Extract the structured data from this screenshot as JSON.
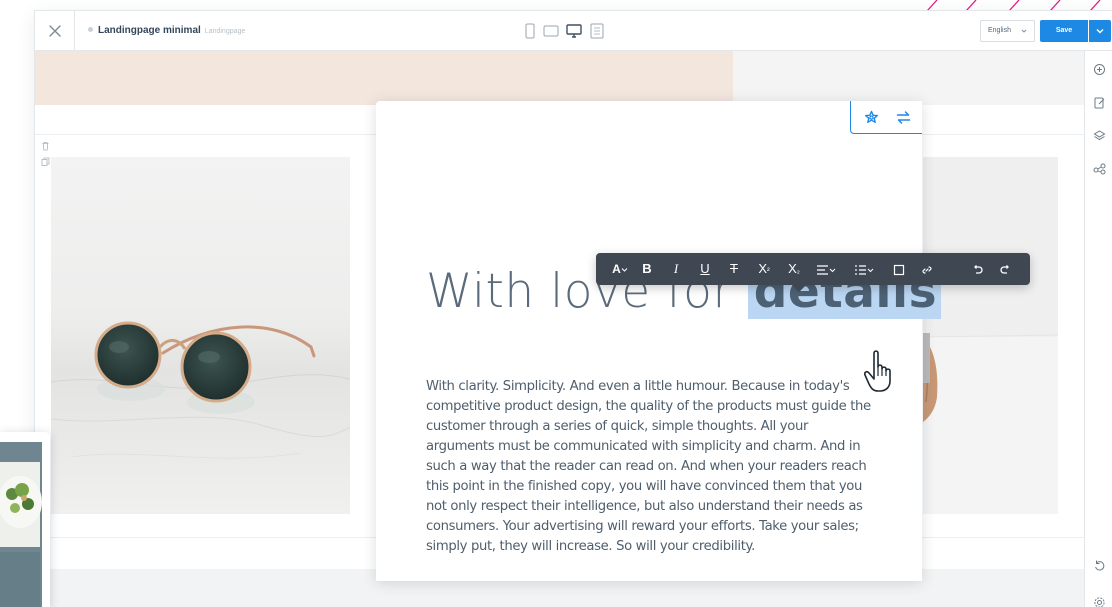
{
  "toolbar": {
    "page_name": "Landingpage minimal",
    "page_type": "Landingpage",
    "language": "English",
    "save_label": "Save"
  },
  "icons": {
    "close": "close-icon",
    "devices": [
      "mobile-icon",
      "tablet-icon",
      "desktop-icon",
      "page-icon"
    ],
    "rail": [
      "add-circle-icon",
      "edit-icon",
      "layers-icon",
      "share-icon",
      "undo-icon",
      "settings-icon"
    ],
    "card_tools": [
      "flower-icon",
      "swap-icon"
    ],
    "block_tools": [
      "trash-icon",
      "copy-icon"
    ]
  },
  "editor": {
    "heading_plain": "With love for ",
    "heading_highlight": "details",
    "body": "With clarity. Simplicity. And even a little humour. Because in today's competitive product design, the quality of the products must guide the customer through a series of quick, simple thoughts. All your arguments must be communicated with simplicity and charm. And in such a way that the reader can read on. And when your readers reach this point in the finished copy, you will have convinced them that you not only respect their intelligence, but also understand their needs as consumers. Your advertising will reward your efforts. Take your sales; simply put, they will increase. So will your credibility."
  },
  "rte": {
    "font": "A",
    "bold": "B",
    "italic": "I",
    "underline": "U",
    "strike": "T",
    "superscript": "X",
    "subscript": "X",
    "superscript_mark": "²",
    "subscript_mark": "₂"
  },
  "colors": {
    "accent": "#1e88e5",
    "highlight": "#bad6f2",
    "toolbar_bg": "#3f4852",
    "band_peach": "#f3e6dd",
    "deco_magenta": "#e6197f"
  }
}
